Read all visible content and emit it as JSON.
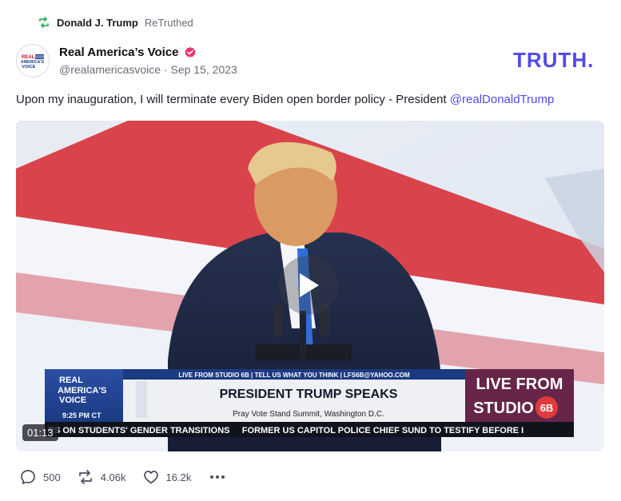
{
  "retruth": {
    "name": "Donald J. Trump",
    "label": "ReTruthed",
    "icon": "retruth-icon"
  },
  "author": {
    "name": "Real America’s Voice",
    "handle": "@realamericasvoice",
    "separator": "·",
    "date": "Sep 15, 2023",
    "avatar_text": [
      "REAL",
      "AMERICA'S",
      "VOICE"
    ],
    "verified_icon": "verified-badge-icon"
  },
  "brand": {
    "logo_text": "TRUTH.",
    "color": "#5448ee"
  },
  "post": {
    "text": "Upon my inauguration, I will terminate every Biden open border policy - President ",
    "mention": "@realDonaldTrump"
  },
  "media": {
    "duration": "01:13",
    "play_icon": "play-icon",
    "lower_third": {
      "network_lines": [
        "REAL",
        "AMERICA'S",
        "VOICE"
      ],
      "time": "9:25 PM CT",
      "top_bar": "LIVE FROM STUDIO 6B | TELL US WHAT YOU THINK | LFS6B@YAHOO.COM",
      "headline": "PRESIDENT TRUMP SPEAKS",
      "subline": "Pray Vote Stand Summit, Washington D.C.",
      "badge_line1": "LIVE FROM",
      "badge_line2": "STUDIO",
      "badge_num": "6B",
      "ticker": "RS ON STUDENTS' GENDER TRANSITIONS     FORMER US CAPITOL POLICE CHIEF SUND TO TESTIFY BEFORE I"
    }
  },
  "actions": {
    "replies": "500",
    "retruths": "4.06k",
    "likes": "16.2k"
  }
}
